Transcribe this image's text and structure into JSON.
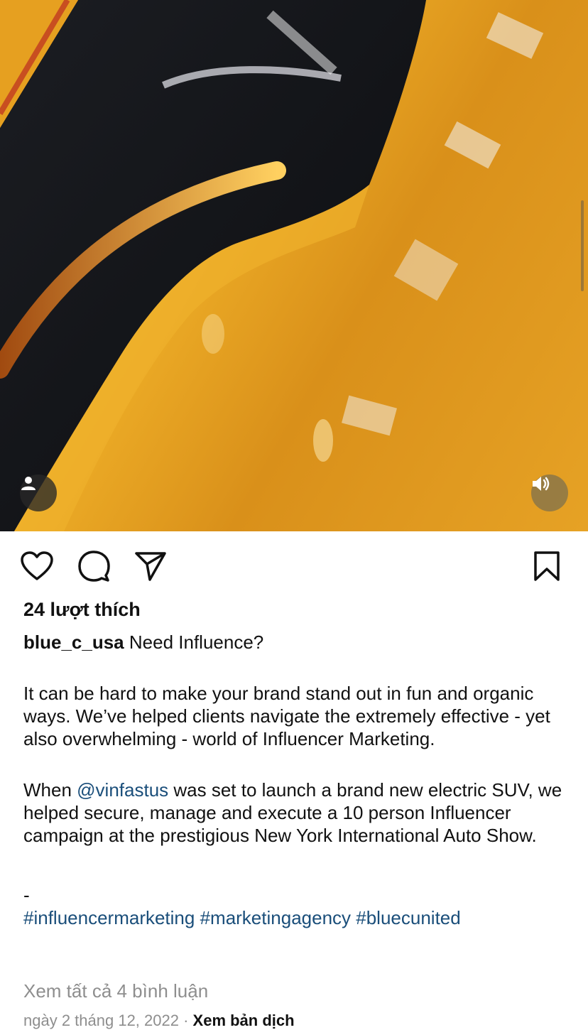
{
  "post": {
    "likes": "24 lượt thích",
    "username": "blue_c_usa",
    "caption_first": "Need Influence?",
    "paragraph1": "It can be hard to make your brand stand out in fun and organic ways. We’ve helped clients navigate the extremely effective - yet also overwhelming - world of Influencer Marketing.",
    "p2_before": "When ",
    "mention": "@vinfastus",
    "p2_after": " was set to launch a brand new electric SUV, we helped secure, manage and execute a 10 person Influencer campaign at the prestigious New York International Auto Show.",
    "dash": "-",
    "hashtags": "#influencermarketing #marketingagency #bluecunited",
    "view_comments": "Xem tất cả 4 bình luận",
    "date": "ngày 2 tháng 12, 2022",
    "separator": " · ",
    "translate": "Xem bản dịch"
  },
  "icons": {
    "tag": "person-tag-icon",
    "sound": "speaker-icon",
    "like": "heart-icon",
    "comment": "comment-bubble-icon",
    "share": "paper-plane-icon",
    "save": "bookmark-icon"
  },
  "colors": {
    "link": "#1a4e7a",
    "muted": "#8e8e8e",
    "media_yellow": "#f2b42a"
  }
}
